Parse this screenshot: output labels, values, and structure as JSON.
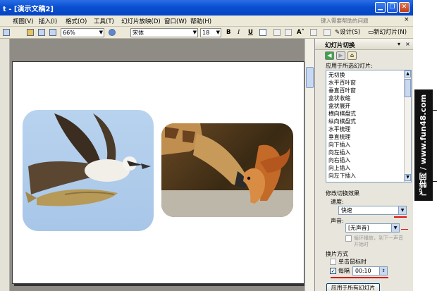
{
  "title_bar": {
    "title": "t - [演示文稿2]"
  },
  "menu": {
    "items": [
      "视图(V)",
      "插入(I)",
      "格式(O)",
      "工具(T)",
      "幻灯片放映(D)",
      "窗口(W)",
      "帮助(H)"
    ],
    "help_placeholder": "键入需要帮助的问题",
    "close_glyph": "×"
  },
  "toolbar": {
    "zoom": "66%",
    "font": "宋体",
    "font_size": "18",
    "bold": "B",
    "italic": "I",
    "underline": "U",
    "design": "设计(S)",
    "new_slide": "新幻灯片(N)"
  },
  "task_pane": {
    "title": "幻灯片切换",
    "apply_to_selected": "应用于所选幻灯片:",
    "transitions": [
      "无切换",
      "水平百叶窗",
      "垂直百叶窗",
      "盒状收缩",
      "盒状展开",
      "横向棋盘式",
      "纵向棋盘式",
      "水平梳理",
      "垂直梳理",
      "向下插入",
      "向左插入",
      "向右插入",
      "向上插入",
      "向左下插入"
    ],
    "modify_effect": "修改切换效果",
    "speed_label": "速度:",
    "speed_value": "快速",
    "sound_label": "声音:",
    "sound_value": "[无声音]",
    "loop_label_1": "循环播放，到下一声音",
    "loop_label_2": "开始时",
    "advance_label": "换片方式",
    "on_click_label": "单击鼠标时",
    "every_label": "每隔",
    "every_value": "00:10",
    "apply_all": "应用于所有幻灯片"
  },
  "watermark": {
    "text": "飞特网 / www.fun48.com"
  },
  "colors": {
    "titlebar": "#0a4fd0",
    "highlight": "#dd1111",
    "pane": "#e8e6dc"
  }
}
